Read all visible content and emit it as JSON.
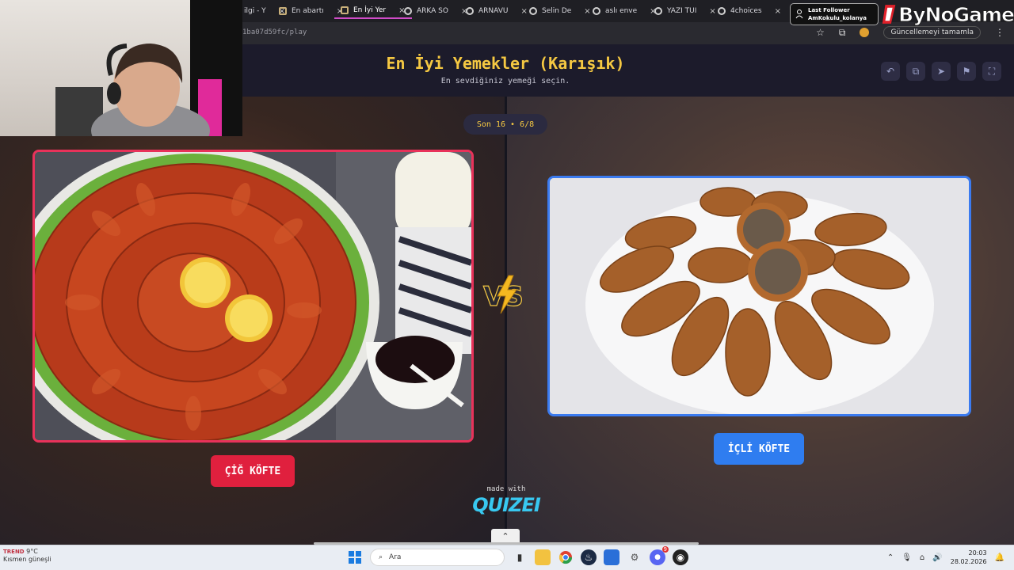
{
  "browser": {
    "tabs": [
      {
        "label": "ilgi - Y",
        "active": false
      },
      {
        "label": "En abartı",
        "active": false
      },
      {
        "label": "En İyi Yer",
        "active": true
      },
      {
        "label": "ARKA SO",
        "active": false
      },
      {
        "label": "ARNAVU",
        "active": false
      },
      {
        "label": "Selin De",
        "active": false
      },
      {
        "label": "aslı enve",
        "active": false
      },
      {
        "label": "YAZI TUI",
        "active": false
      },
      {
        "label": "4choices",
        "active": false
      }
    ],
    "url": "1ba07d59fc/play",
    "update_label": "Güncellemeyi tamamla"
  },
  "quiz": {
    "title": "En İyi Yemekler (Karışık)",
    "subtitle": "En sevdiğiniz yemeği seçin.",
    "round": "Son 16 • 6/8",
    "left_choice": "ÇİĞ KÖFTE",
    "right_choice": "İÇLİ KÖFTE",
    "vs_text": "VS",
    "made_with": "made with",
    "brand": "QUIZEI",
    "accent_left": "#e0203e",
    "accent_right": "#2f7df0",
    "title_color": "#f5c842"
  },
  "overlay": {
    "follower_title": "Last Follower",
    "follower_name": "AmKokulu_kolanya",
    "sponsor": "ByNoGame"
  },
  "taskbar": {
    "weather_temp": "9°C",
    "weather_desc": "Kısmen güneşli",
    "weather_badge": "TREND",
    "search_placeholder": "Ara",
    "notif_count": "9",
    "time": "20:03",
    "date": "28.02.2026"
  }
}
